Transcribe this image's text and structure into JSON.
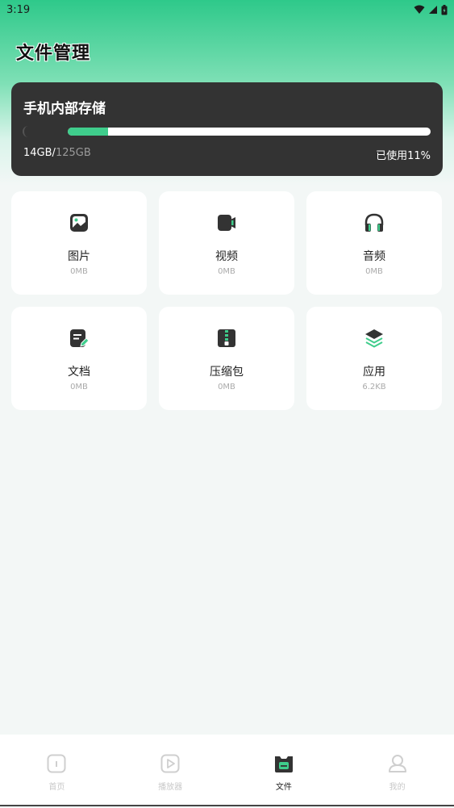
{
  "status_bar": {
    "time": "3:19"
  },
  "page": {
    "title": "文件管理"
  },
  "storage": {
    "title": "手机内部存储",
    "used": "14GB",
    "separator": "/",
    "total": "125GB",
    "percent_label": "已使用11%",
    "percent_value": 11
  },
  "categories": [
    {
      "label": "图片",
      "size": "0MB",
      "icon": "image-icon"
    },
    {
      "label": "视频",
      "size": "0MB",
      "icon": "video-icon"
    },
    {
      "label": "音频",
      "size": "0MB",
      "icon": "headphones-icon"
    },
    {
      "label": "文档",
      "size": "0MB",
      "icon": "document-icon"
    },
    {
      "label": "压缩包",
      "size": "0MB",
      "icon": "zip-icon"
    },
    {
      "label": "应用",
      "size": "6.2KB",
      "icon": "layers-icon"
    }
  ],
  "bottom_nav": [
    {
      "label": "首页",
      "icon": "home-icon",
      "active": false
    },
    {
      "label": "播放器",
      "icon": "play-icon",
      "active": false
    },
    {
      "label": "文件",
      "icon": "folder-icon",
      "active": true
    },
    {
      "label": "我的",
      "icon": "profile-icon",
      "active": false
    }
  ],
  "colors": {
    "accent": "#3fcd8c",
    "card_dark": "#333333",
    "icon_dark": "#333333"
  }
}
